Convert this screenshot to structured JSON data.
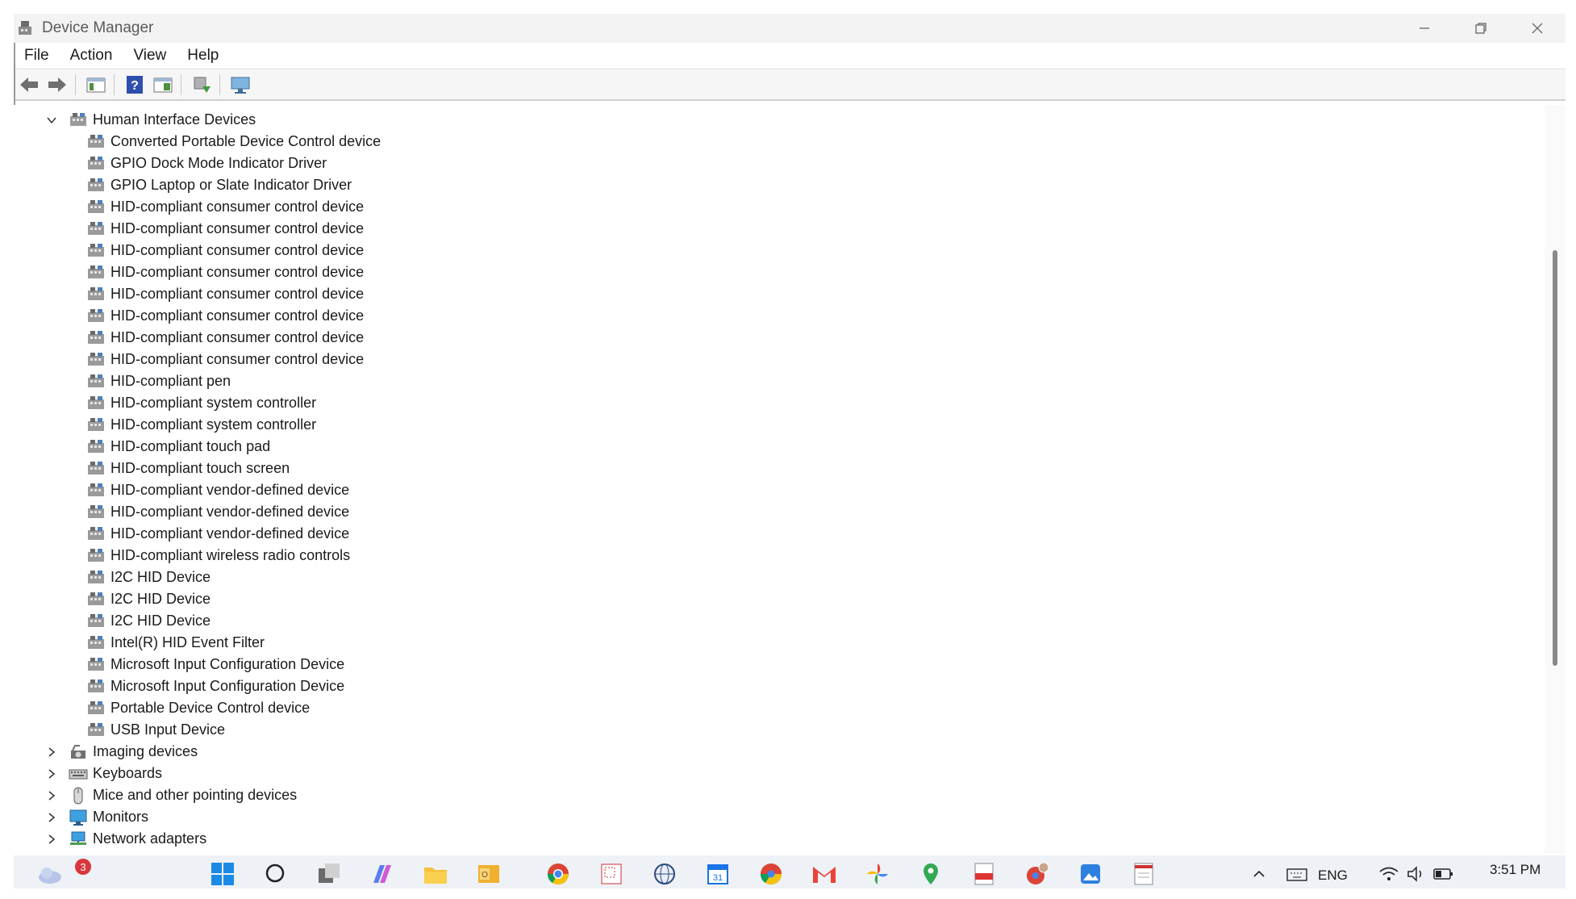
{
  "window": {
    "title": "Device Manager"
  },
  "menu": [
    "File",
    "Action",
    "View",
    "Help"
  ],
  "tree": {
    "expanded_category": "Human Interface Devices",
    "hid_devices": [
      "Converted Portable Device Control device",
      "GPIO Dock Mode Indicator Driver",
      "GPIO Laptop or Slate Indicator Driver",
      "HID-compliant consumer control device",
      "HID-compliant consumer control device",
      "HID-compliant consumer control device",
      "HID-compliant consumer control device",
      "HID-compliant consumer control device",
      "HID-compliant consumer control device",
      "HID-compliant consumer control device",
      "HID-compliant consumer control device",
      "HID-compliant pen",
      "HID-compliant system controller",
      "HID-compliant system controller",
      "HID-compliant touch pad",
      "HID-compliant touch screen",
      "HID-compliant vendor-defined device",
      "HID-compliant vendor-defined device",
      "HID-compliant vendor-defined device",
      "HID-compliant wireless radio controls",
      "I2C HID Device",
      "I2C HID Device",
      "I2C HID Device",
      "Intel(R) HID Event Filter",
      "Microsoft Input Configuration Device",
      "Microsoft Input Configuration Device",
      "Portable Device Control device",
      "USB Input Device"
    ],
    "collapsed_categories": [
      "Imaging devices",
      "Keyboards",
      "Mice and other pointing devices",
      "Monitors",
      "Network adapters"
    ]
  },
  "taskbar": {
    "weather_badge": "3",
    "language": "ENG",
    "time": "3:51 PM"
  }
}
